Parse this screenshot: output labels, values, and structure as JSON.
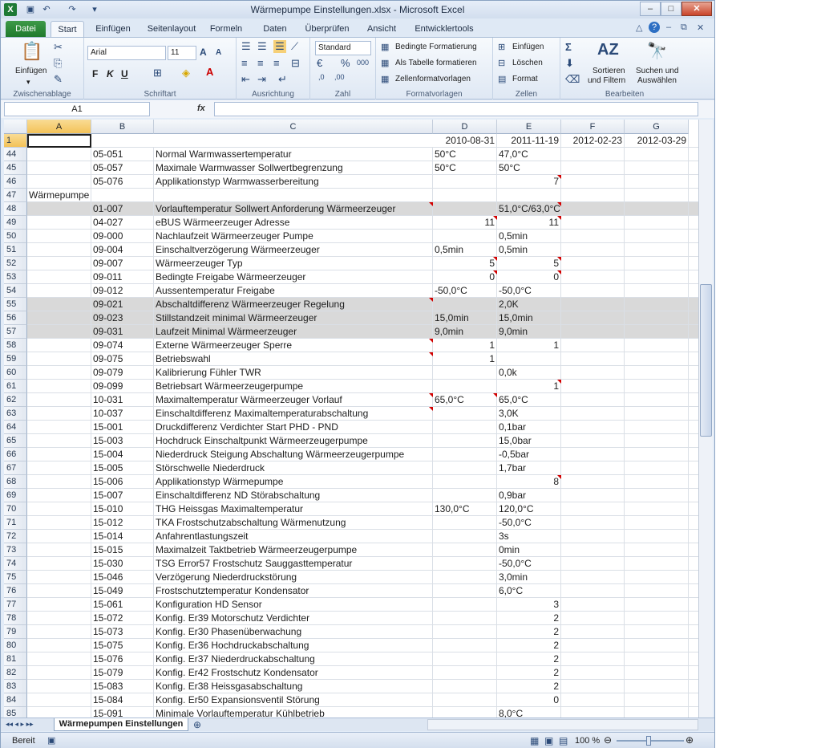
{
  "window": {
    "title": "Wärmepumpe Einstellungen.xlsx - Microsoft Excel"
  },
  "tabs": [
    {
      "label": "Datei"
    },
    {
      "label": "Start"
    },
    {
      "label": "Einfügen"
    },
    {
      "label": "Seitenlayout"
    },
    {
      "label": "Formeln"
    },
    {
      "label": "Daten"
    },
    {
      "label": "Überprüfen"
    },
    {
      "label": "Ansicht"
    },
    {
      "label": "Entwicklertools"
    }
  ],
  "ribbon": {
    "clipboard": {
      "paste": "Einfügen",
      "group": "Zwischenablage"
    },
    "font": {
      "name": "Arial",
      "size": "11",
      "bold": "F",
      "italic": "K",
      "underline": "U",
      "group": "Schriftart"
    },
    "alignment": {
      "group": "Ausrichtung"
    },
    "number": {
      "format": "Standard",
      "group": "Zahl"
    },
    "styles": {
      "cond": "Bedingte Formatierung",
      "table": "Als Tabelle formatieren",
      "cell": "Zellenformatvorlagen",
      "group": "Formatvorlagen"
    },
    "cells": {
      "insert": "Einfügen",
      "delete": "Löschen",
      "format": "Format",
      "group": "Zellen"
    },
    "editing": {
      "sort1": "Sortieren",
      "sort2": "und Filtern",
      "find1": "Suchen und",
      "find2": "Auswählen",
      "group": "Bearbeiten"
    }
  },
  "formula": {
    "namebox": "A1",
    "fx": "fx"
  },
  "columns": [
    "A",
    "B",
    "C",
    "D",
    "E",
    "F",
    "G"
  ],
  "header_row": {
    "num": "1",
    "d": "2010-08-31",
    "e": "2011-11-19",
    "f": "2012-02-23",
    "g": "2012-03-29"
  },
  "rows": [
    {
      "num": "44",
      "b": "05-051",
      "c": "Normal Warmwassertemperatur",
      "d": "50°C",
      "e": "47,0°C"
    },
    {
      "num": "45",
      "b": "05-057",
      "c": "Maximale Warmwasser Sollwertbegrenzung",
      "d": "50°C",
      "e": "50°C"
    },
    {
      "num": "46",
      "b": "05-076",
      "c": "Applikationstyp Warmwasserbereitung",
      "d": "",
      "e": "7"
    },
    {
      "num": "47",
      "a": "Wärmepumpe",
      "b": "",
      "c": "",
      "d": "",
      "e": ""
    },
    {
      "num": "48",
      "b": "01-007",
      "c": "Vorlauftemperatur Sollwert Anforderung Wärmeerzeuger",
      "d": "",
      "e": "51,0°C/63,0°C"
    },
    {
      "num": "49",
      "b": "04-027",
      "c": "eBUS Wärmeerzeuger Adresse",
      "d": "11",
      "e": "11"
    },
    {
      "num": "50",
      "b": "09-000",
      "c": "Nachlaufzeit Wärmeerzeuger Pumpe",
      "d": "",
      "e": "0,5min"
    },
    {
      "num": "51",
      "b": "09-004",
      "c": "Einschaltverzögerung Wärmeerzeuger",
      "d": "0,5min",
      "e": "0,5min"
    },
    {
      "num": "52",
      "b": "09-007",
      "c": "Wärmeerzeuger Typ",
      "d": "5",
      "e": "5"
    },
    {
      "num": "53",
      "b": "09-011",
      "c": "Bedingte Freigabe Wärmeerzeuger",
      "d": "0",
      "e": "0"
    },
    {
      "num": "54",
      "b": "09-012",
      "c": "Aussentemperatur Freigabe",
      "d": "-50,0°C",
      "e": "-50,0°C"
    },
    {
      "num": "55",
      "b": "09-021",
      "c": "Abschaltdifferenz Wärmeerzeuger Regelung",
      "d": "",
      "e": "2,0K"
    },
    {
      "num": "56",
      "b": "09-023",
      "c": "Stillstandzeit minimal Wärmeerzeuger",
      "d": "15,0min",
      "e": "15,0min"
    },
    {
      "num": "57",
      "b": "09-031",
      "c": "Laufzeit Minimal Wärmeerzeuger",
      "d": "9,0min",
      "e": "9,0min"
    },
    {
      "num": "58",
      "b": "09-074",
      "c": "Externe Wärmeerzeuger Sperre",
      "d": "1",
      "e": "1"
    },
    {
      "num": "59",
      "b": "09-075",
      "c": "Betriebswahl",
      "d": "1",
      "e": ""
    },
    {
      "num": "60",
      "b": "09-079",
      "c": "Kalibrierung Fühler TWR",
      "d": "",
      "e": "0,0k"
    },
    {
      "num": "61",
      "b": "09-099",
      "c": "Betriebsart Wärmeerzeugerpumpe",
      "d": "",
      "e": "1"
    },
    {
      "num": "62",
      "b": "10-031",
      "c": "Maximaltemperatur Wärmeerzeuger Vorlauf",
      "d": "65,0°C",
      "e": "65,0°C"
    },
    {
      "num": "63",
      "b": "10-037",
      "c": "Einschaltdifferenz Maximaltemperaturabschaltung",
      "d": "",
      "e": "3,0K"
    },
    {
      "num": "64",
      "b": "15-001",
      "c": "Druckdifferenz Verdichter Start PHD - PND",
      "d": "",
      "e": "0,1bar"
    },
    {
      "num": "65",
      "b": "15-003",
      "c": "Hochdruck Einschaltpunkt Wärmeerzeugerpumpe",
      "d": "",
      "e": "15,0bar"
    },
    {
      "num": "66",
      "b": "15-004",
      "c": "Niederdruck Steigung Abschaltung Wärmeerzeugerpumpe",
      "d": "",
      "e": "-0,5bar"
    },
    {
      "num": "67",
      "b": "15-005",
      "c": "Störschwelle Niederdruck",
      "d": "",
      "e": "1,7bar"
    },
    {
      "num": "68",
      "b": "15-006",
      "c": "Applikationstyp Wärmepumpe",
      "d": "",
      "e": "8"
    },
    {
      "num": "69",
      "b": "15-007",
      "c": "Einschaltdifferenz ND Störabschaltung",
      "d": "",
      "e": "0,9bar"
    },
    {
      "num": "70",
      "b": "15-010",
      "c": "THG Heissgas Maximaltemperatur",
      "d": "130,0°C",
      "e": "120,0°C"
    },
    {
      "num": "71",
      "b": "15-012",
      "c": "TKA Frostschutzabschaltung Wärmenutzung",
      "d": "",
      "e": "-50,0°C"
    },
    {
      "num": "72",
      "b": "15-014",
      "c": "Anfahrentlastungszeit",
      "d": "",
      "e": "3s"
    },
    {
      "num": "73",
      "b": "15-015",
      "c": "Maximalzeit Taktbetrieb Wärmeerzeugerpumpe",
      "d": "",
      "e": "0min"
    },
    {
      "num": "74",
      "b": "15-030",
      "c": "TSG Error57 Frostschutz Sauggasttemperatur",
      "d": "",
      "e": "-50,0°C"
    },
    {
      "num": "75",
      "b": "15-046",
      "c": "Verzögerung Niederdruckstörung",
      "d": "",
      "e": "3,0min"
    },
    {
      "num": "76",
      "b": "15-049",
      "c": "Frostschutztemperatur Kondensator",
      "d": "",
      "e": "6,0°C"
    },
    {
      "num": "77",
      "b": "15-061",
      "c": "Konfiguration HD Sensor",
      "d": "",
      "e": "3"
    },
    {
      "num": "78",
      "b": "15-072",
      "c": "Konfig. Er39 Motorschutz Verdichter",
      "d": "",
      "e": "2"
    },
    {
      "num": "79",
      "b": "15-073",
      "c": "Konfig. Er30 Phasenüberwachung",
      "d": "",
      "e": "2"
    },
    {
      "num": "80",
      "b": "15-075",
      "c": "Konfig. Er36 Hochdruckabschaltung",
      "d": "",
      "e": "2"
    },
    {
      "num": "81",
      "b": "15-076",
      "c": "Konfig. Er37 Niederdruckabschaltung",
      "d": "",
      "e": "2"
    },
    {
      "num": "82",
      "b": "15-079",
      "c": "Konfig. Er42 Frostschutz Kondensator",
      "d": "",
      "e": "2"
    },
    {
      "num": "83",
      "b": "15-083",
      "c": "Konfig. Er38 Heissgasabschaltung",
      "d": "",
      "e": "2"
    },
    {
      "num": "84",
      "b": "15-084",
      "c": "Konfig. Er50 Expansionsventil Störung",
      "d": "",
      "e": "0"
    },
    {
      "num": "85",
      "b": "15-091",
      "c": "Minimale Vorlauftemperatur Kühlbetrieb",
      "d": "",
      "e": "8,0°C"
    }
  ],
  "sheet": {
    "tab": "Wärmepumpen Einstellungen"
  },
  "status": {
    "ready": "Bereit",
    "zoom": "100 %"
  }
}
